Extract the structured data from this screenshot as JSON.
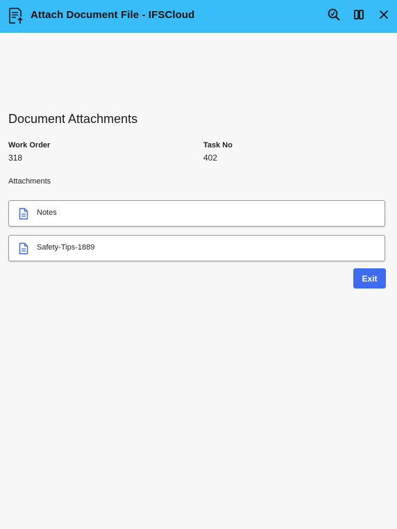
{
  "window": {
    "title": "Attach Document File - IFSCloud",
    "icons": {
      "app": "document-upload-icon",
      "search": "zoom-search-icon",
      "split": "split-view-icon",
      "close": "close-icon"
    }
  },
  "page": {
    "heading": "Document Attachments",
    "work_order": {
      "label": "Work Order",
      "value": "318"
    },
    "task_no": {
      "label": "Task No",
      "value": "402"
    },
    "attachments_label": "Attachments",
    "attachments": [
      {
        "name": "Notes",
        "icon": "document-icon"
      },
      {
        "name": "Safety-Tips-1889",
        "icon": "document-icon"
      }
    ],
    "exit_label": "Exit"
  },
  "colors": {
    "titlebar": "#38bdf8",
    "accent": "#3d6cf0",
    "background": "#f7f7f7",
    "doc_icon": "#3d6cf0"
  }
}
